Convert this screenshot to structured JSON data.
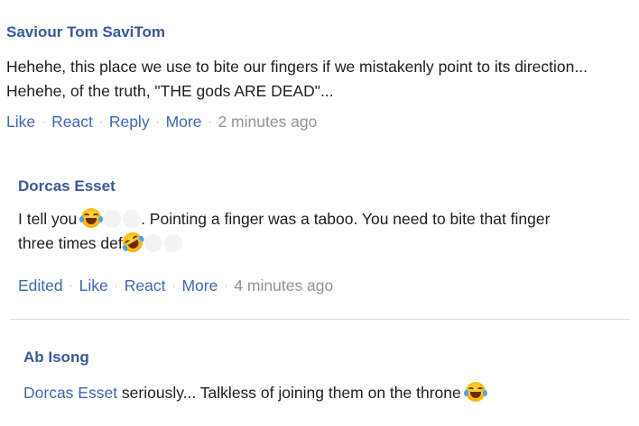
{
  "comments": [
    {
      "author": "Saviour Tom SaviTom",
      "line1": "Hehehe, this place we use to bite our fingers if we mistakenly point to its direction...",
      "line2": "Hehehe, of the truth, \"THE  gods ARE DEAD\"...",
      "actions": {
        "like": "Like",
        "react": "React",
        "reply": "Reply",
        "more": "More"
      },
      "time": "2 minutes ago"
    },
    {
      "author": "Dorcas Esset",
      "line1_a": "I tell you",
      "line1_b": ". Pointing a finger was a taboo. You need to bite that finger",
      "line2": "three times def",
      "actions": {
        "edited": "Edited",
        "like": "Like",
        "react": "React",
        "more": "More"
      },
      "time": "4 minutes ago"
    },
    {
      "author": "Ab Isong",
      "mention": "Dorcas Esset",
      "text": " seriously...  Talkless of joining them on the throne"
    }
  ],
  "icons": {
    "emoji": "laughing-crying-emoji-icon",
    "rofl": "rolling-laughing-emoji-icon"
  },
  "colors": {
    "author": "#3b5998",
    "link": "#4267b2",
    "muted": "#8d949e",
    "divider": "#dadde1"
  }
}
